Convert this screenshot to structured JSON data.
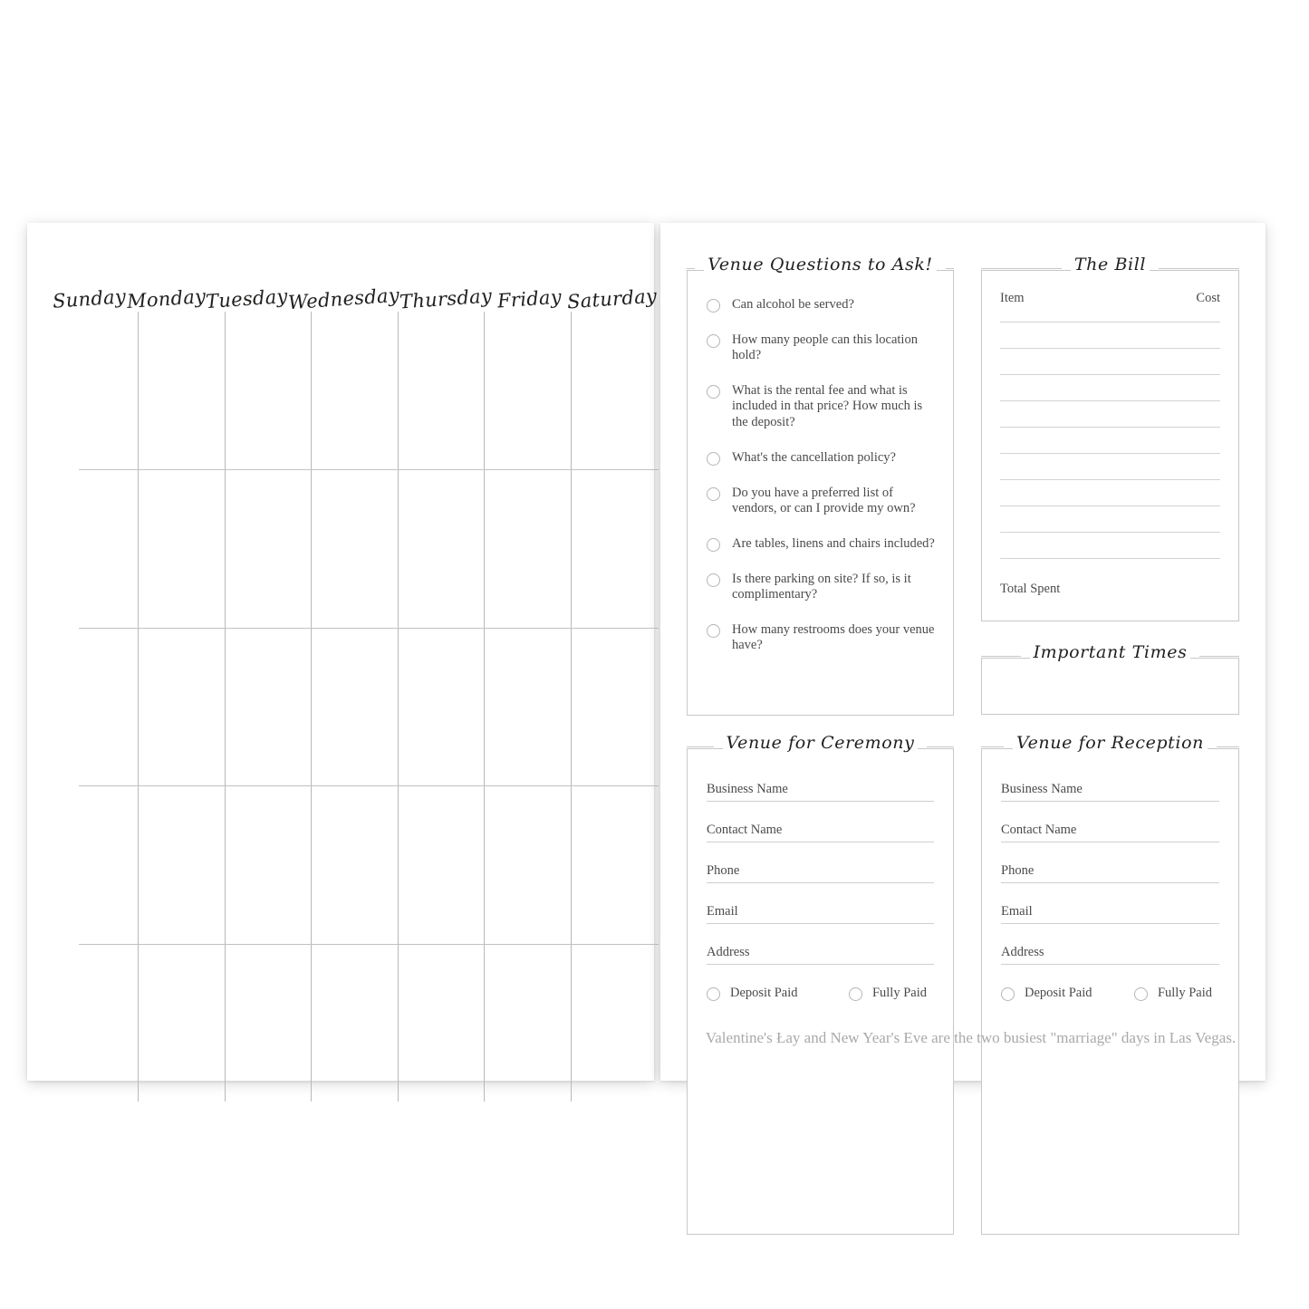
{
  "calendar": {
    "days": [
      "Sunday",
      "Monday",
      "Tuesday",
      "Wednesday",
      "Thursday",
      "Friday",
      "Saturday"
    ],
    "rows": 5
  },
  "questions_panel": {
    "title": "Venue Questions to Ask!",
    "items": [
      "Can alcohol be served?",
      "How many people can this location hold?",
      "What is the rental fee and what is included in that price? How much is the deposit?",
      "What's the cancellation policy?",
      "Do you have a preferred list of vendors, or can I  provide my own?",
      "Are tables, linens and chairs included?",
      "Is there parking on site? If so, is it complimentary?",
      "How many restrooms does your venue have?"
    ]
  },
  "bill_panel": {
    "title": "The Bill",
    "col_item": "Item",
    "col_cost": "Cost",
    "line_count": 10,
    "total_label": "Total Spent"
  },
  "times_panel": {
    "title": "Important Times"
  },
  "ceremony_panel": {
    "title": "Venue for Ceremony",
    "fields": [
      "Business Name",
      "Contact Name",
      "Phone",
      "Email",
      "Address"
    ],
    "deposit_label": "Deposit Paid",
    "fully_label": "Fully Paid"
  },
  "reception_panel": {
    "title": "Venue for Reception",
    "fields": [
      "Business Name",
      "Contact Name",
      "Phone",
      "Email",
      "Address"
    ],
    "deposit_label": "Deposit Paid",
    "fully_label": "Fully Paid"
  },
  "footer": {
    "fact": "Valentine's Łay and New Year's Eve are the two busiest \"marriage\" days in Las Vegas."
  },
  "colors": {
    "ink": "#2b2b2b",
    "body_text": "#4a4a4a",
    "rule": "#c8c8c8",
    "grid_line": "#bdbdbd",
    "footer_text": "#a9a9a9",
    "paper": "#ffffff"
  }
}
